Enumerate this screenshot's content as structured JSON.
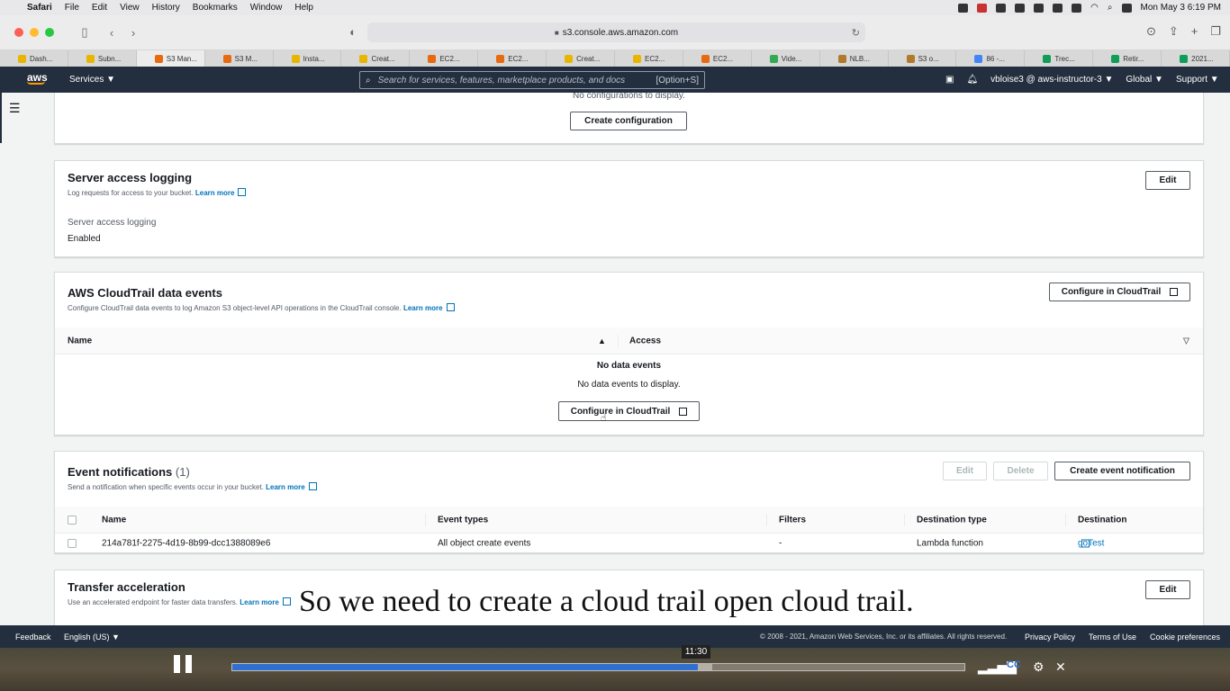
{
  "menubar": {
    "app": "Safari",
    "items": [
      "File",
      "Edit",
      "View",
      "History",
      "Bookmarks",
      "Window",
      "Help"
    ],
    "clock": "Mon May 3  6:19 PM"
  },
  "browser": {
    "url": "s3.console.aws.amazon.com",
    "tabs": [
      {
        "label": "Dash...",
        "color": "#e8b600"
      },
      {
        "label": "Subn...",
        "color": "#e8b600"
      },
      {
        "label": "S3 Man...",
        "color": "#e86a10",
        "active": true
      },
      {
        "label": "S3 M...",
        "color": "#e86a10"
      },
      {
        "label": "Insta...",
        "color": "#e8b600"
      },
      {
        "label": "Creat...",
        "color": "#e8b600"
      },
      {
        "label": "EC2...",
        "color": "#e86a10"
      },
      {
        "label": "EC2...",
        "color": "#e86a10"
      },
      {
        "label": "Creat...",
        "color": "#e8b600"
      },
      {
        "label": "EC2...",
        "color": "#e8b600"
      },
      {
        "label": "EC2...",
        "color": "#e86a10"
      },
      {
        "label": "Vide...",
        "color": "#34a853"
      },
      {
        "label": "NLB...",
        "color": "#b07a2a"
      },
      {
        "label": "S3 o...",
        "color": "#b07a2a"
      },
      {
        "label": "86 -...",
        "color": "#4285f4"
      },
      {
        "label": "Trec...",
        "color": "#0f9d58"
      },
      {
        "label": "Retir...",
        "color": "#0f9d58"
      },
      {
        "label": "2021...",
        "color": "#0f9d58"
      }
    ]
  },
  "awsnav": {
    "logo": "aws",
    "services": "Services",
    "search_placeholder": "Search for services, features, marketplace products, and docs",
    "search_shortcut": "[Option+S]",
    "account": "vbloise3 @ aws-instructor-3",
    "region": "Global",
    "support": "Support"
  },
  "top_panel": {
    "empty_text": "No configurations to display.",
    "button": "Create configuration"
  },
  "logging": {
    "title": "Server access logging",
    "desc": "Log requests for access to your bucket.",
    "learn_more": "Learn more",
    "edit": "Edit",
    "field_label": "Server access logging",
    "field_value": "Enabled"
  },
  "cloudtrail": {
    "title": "AWS CloudTrail data events",
    "desc": "Configure CloudTrail data events to log Amazon S3 object-level API operations in the CloudTrail console.",
    "learn_more": "Learn more",
    "configure_button": "Configure in CloudTrail",
    "columns": [
      "Name",
      "Access"
    ],
    "empty_title": "No data events",
    "empty_text": "No data events to display.",
    "center_button": "Configure in CloudTrail"
  },
  "events": {
    "title": "Event notifications",
    "count": "(1)",
    "desc": "Send a notification when specific events occur in your bucket.",
    "learn_more": "Learn more",
    "edit": "Edit",
    "delete": "Delete",
    "create": "Create event notification",
    "columns": [
      "Name",
      "Event types",
      "Filters",
      "Destination type",
      "Destination"
    ],
    "rows": [
      {
        "name": "214a781f-2275-4d19-8b99-dcc1388089e6",
        "types": "All object create events",
        "filters": "-",
        "dest_type": "Lambda function",
        "dest": "goTest"
      }
    ]
  },
  "transfer": {
    "title": "Transfer acceleration",
    "desc": "Use an accelerated endpoint for faster data transfers.",
    "learn_more": "Learn more",
    "edit": "Edit"
  },
  "subtitle": "So we need to create a cloud trail open cloud trail.",
  "footer": {
    "feedback": "Feedback",
    "language": "English (US)",
    "copyright": "© 2008 - 2021, Amazon Web Services, Inc. or its affiliates. All rights reserved.",
    "privacy": "Privacy Policy",
    "terms": "Terms of Use",
    "cookies": "Cookie preferences"
  },
  "player": {
    "time": "11:30",
    "progress": 0.636,
    "buffered": 0.655
  },
  "colors": {
    "aws_nav": "#232f3e",
    "aws_orange": "#ff9900",
    "link": "#0073bb",
    "player_fill": "#2f6fd0"
  }
}
